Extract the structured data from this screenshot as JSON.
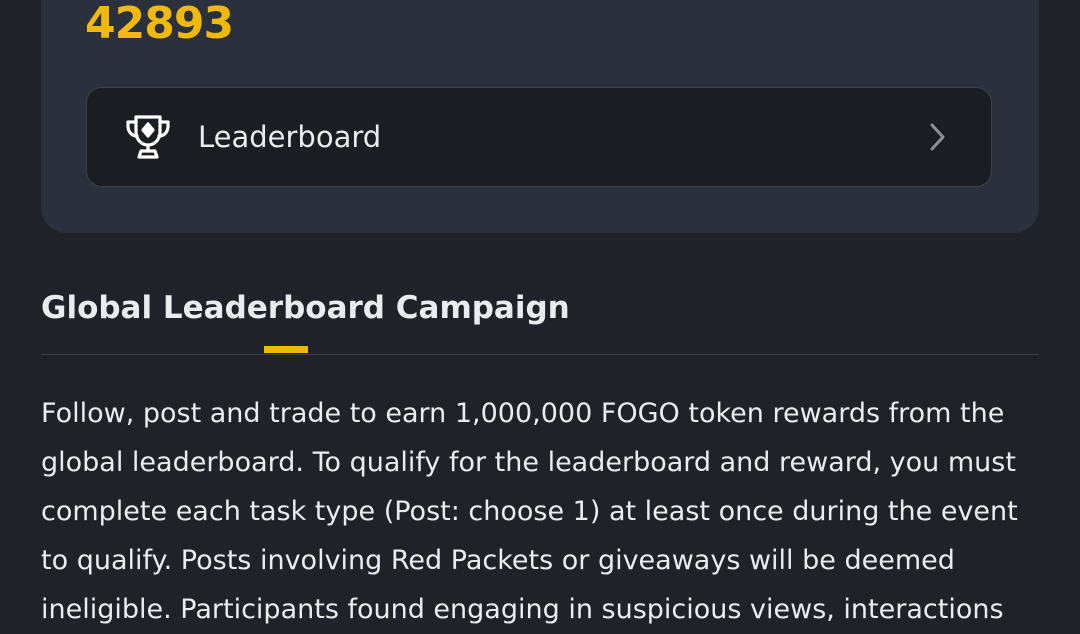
{
  "card": {
    "points_value": "42893",
    "leaderboard_label": "Leaderboard",
    "trophy_icon": "trophy-icon",
    "chevron_icon": "chevron-right-icon"
  },
  "campaign": {
    "title": "Global Leaderboard Campaign",
    "description": "Follow, post and trade to earn 1,000,000 FOGO token rewards from the global leaderboard. To qualify for the leaderboard and reward, you must complete each task type (Post: choose 1) at least once during the event to qualify. Posts involving Red Packets or giveaways will be deemed ineligible. Participants found engaging in suspicious views, interactions"
  },
  "colors": {
    "accent": "#f0b90b",
    "background": "#1f2329",
    "card": "#2b313c",
    "row": "#1c1d22",
    "text": "#eaecef"
  }
}
